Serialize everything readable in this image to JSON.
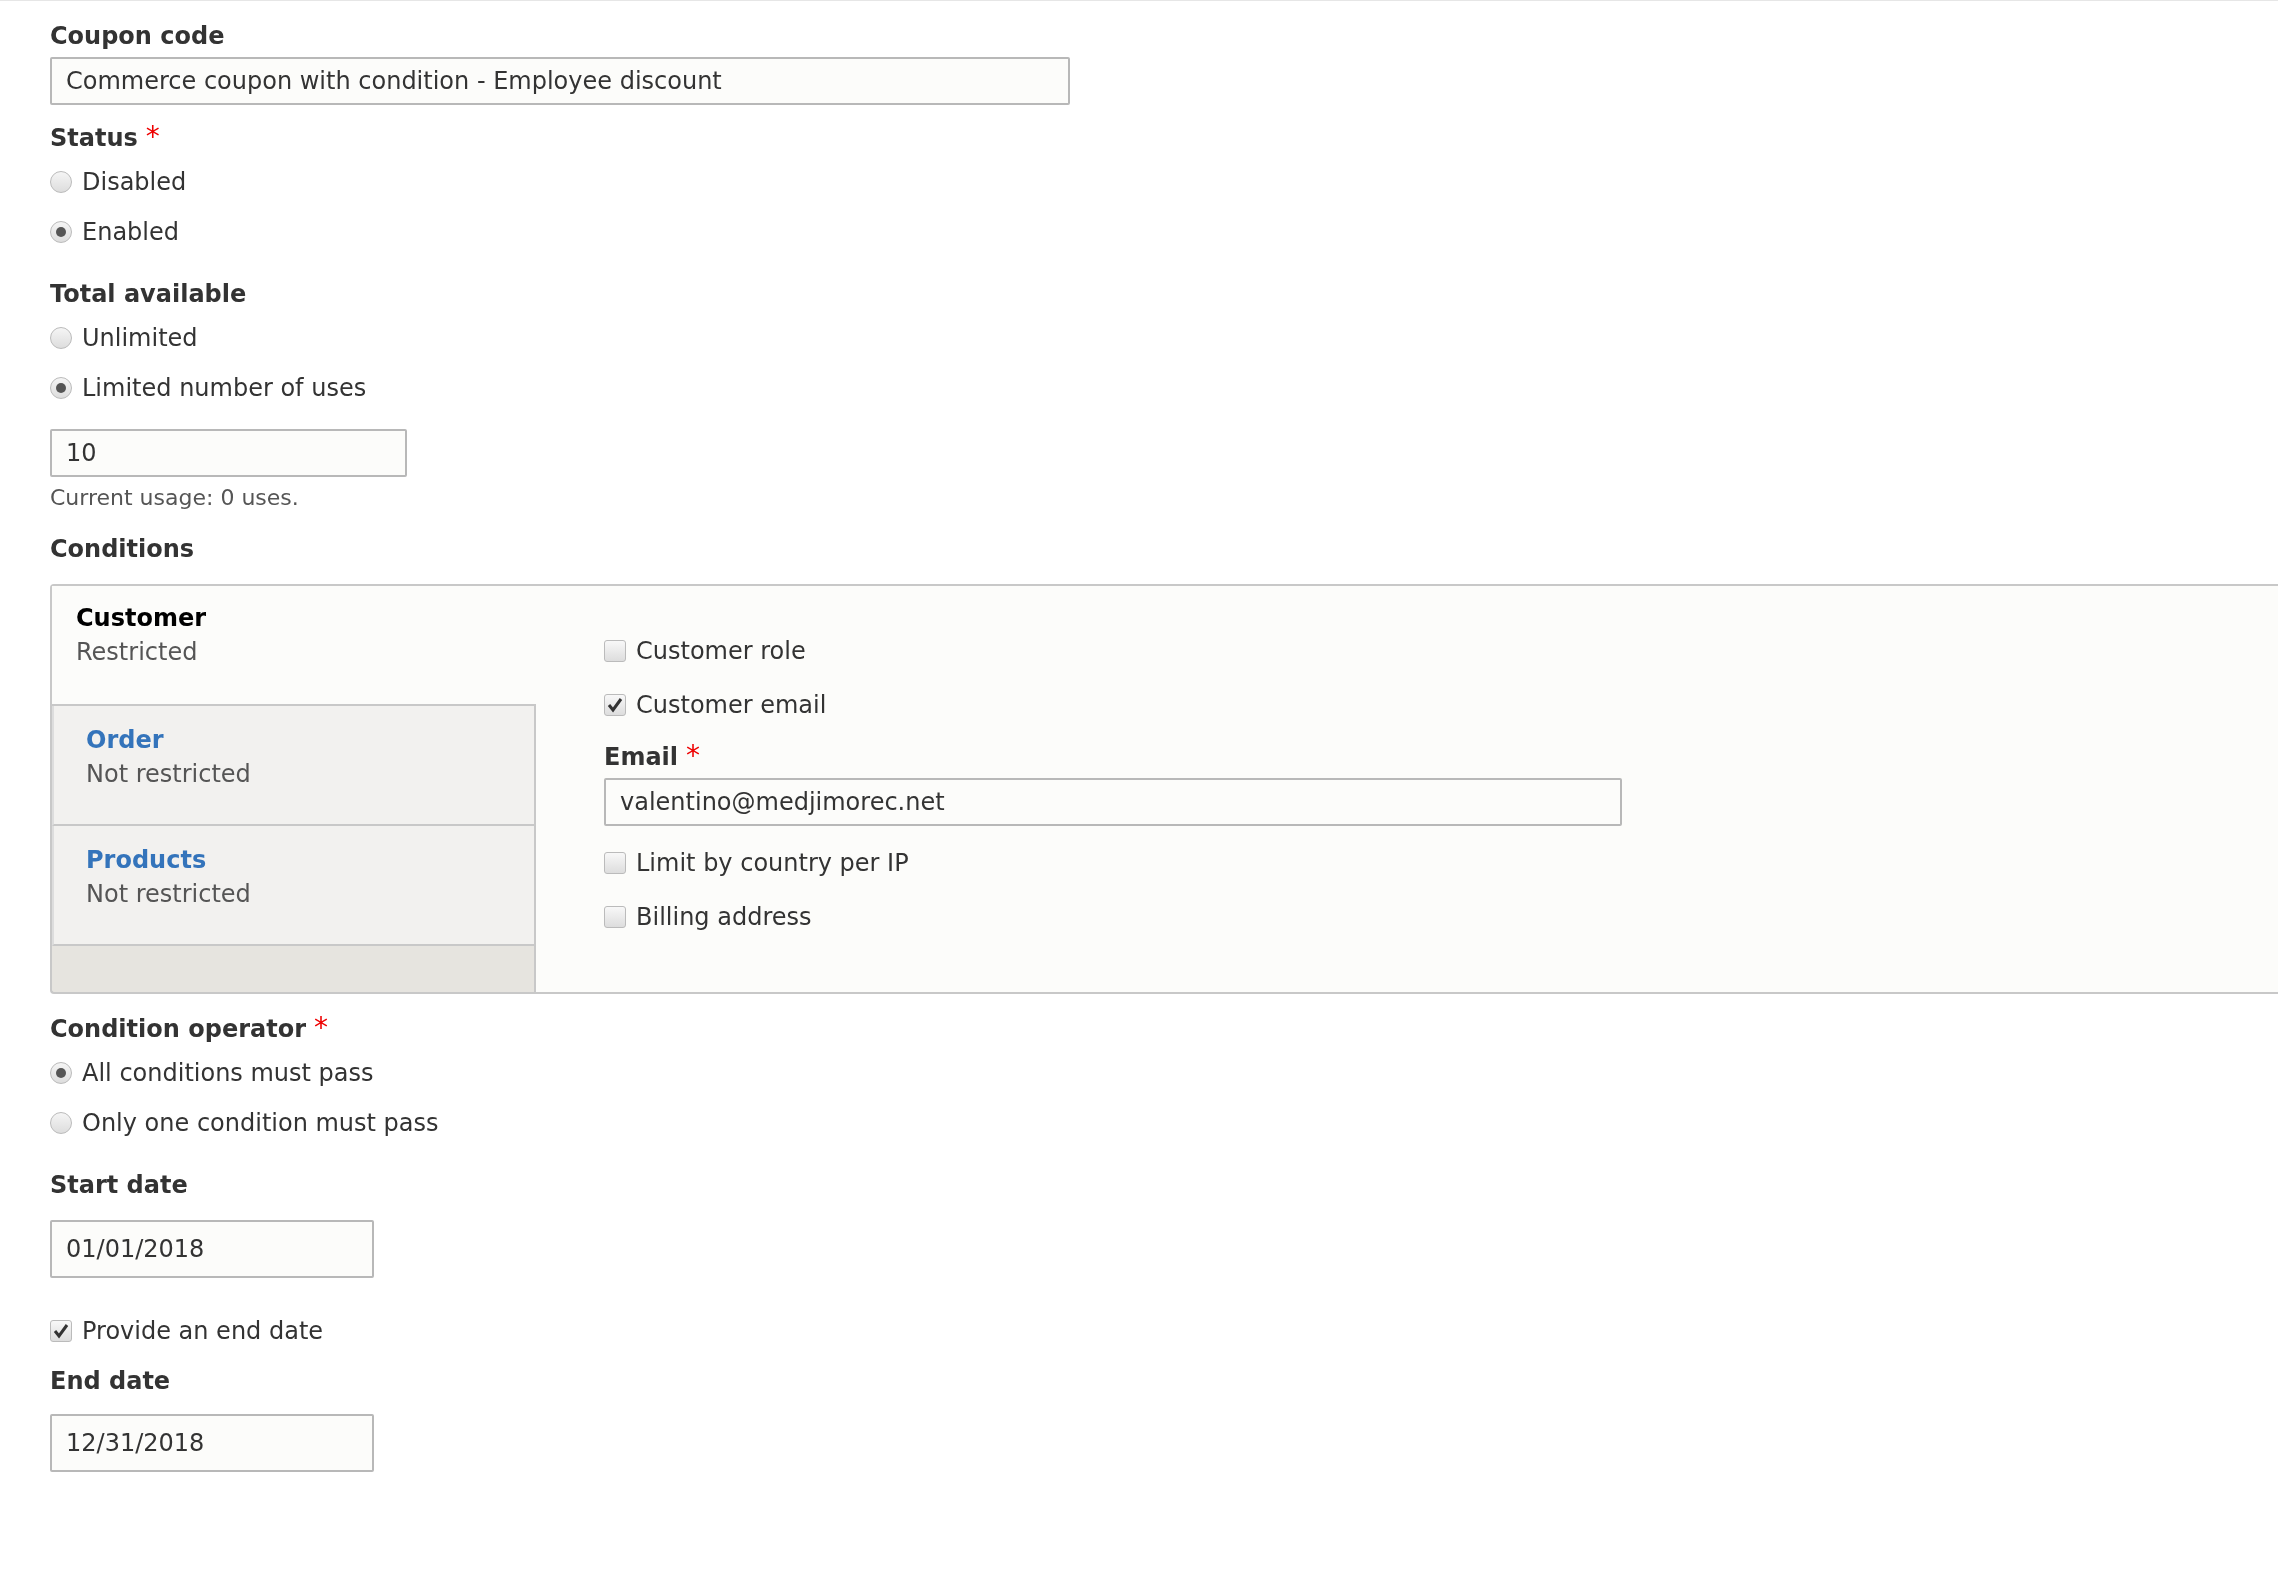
{
  "coupon_code": {
    "label": "Coupon code",
    "value": "Commerce coupon with condition - Employee discount"
  },
  "status": {
    "label": "Status",
    "required_mark": "*",
    "options": [
      {
        "label": "Disabled",
        "selected": false
      },
      {
        "label": "Enabled",
        "selected": true
      }
    ]
  },
  "total_available": {
    "label": "Total available",
    "options": [
      {
        "label": "Unlimited",
        "selected": false
      },
      {
        "label": "Limited number of uses",
        "selected": true
      }
    ],
    "value": "10",
    "description": "Current usage: 0 uses."
  },
  "conditions": {
    "label": "Conditions",
    "tabs": [
      {
        "title": "Customer",
        "summary": "Restricted",
        "selected": true
      },
      {
        "title": "Order",
        "summary": "Not restricted",
        "selected": false
      },
      {
        "title": "Products",
        "summary": "Not restricted",
        "selected": false
      }
    ],
    "items": [
      {
        "kind": "checkbox",
        "label": "Customer role",
        "checked": false
      },
      {
        "kind": "checkbox",
        "label": "Customer email",
        "checked": true
      },
      {
        "kind": "field",
        "label": "Email",
        "required_mark": "*",
        "value": "valentino@medjimorec.net"
      },
      {
        "kind": "checkbox",
        "label": "Limit by country per IP",
        "checked": false
      },
      {
        "kind": "checkbox",
        "label": "Billing address",
        "checked": false
      }
    ]
  },
  "condition_operator": {
    "label": "Condition operator",
    "required_mark": "*",
    "options": [
      {
        "label": "All conditions must pass",
        "selected": true
      },
      {
        "label": "Only one condition must pass",
        "selected": false
      }
    ]
  },
  "start_date": {
    "label": "Start date",
    "value": "01/01/2018"
  },
  "end_date_toggle": {
    "label": "Provide an end date",
    "checked": true
  },
  "end_date": {
    "label": "End date",
    "value": "12/31/2018"
  }
}
